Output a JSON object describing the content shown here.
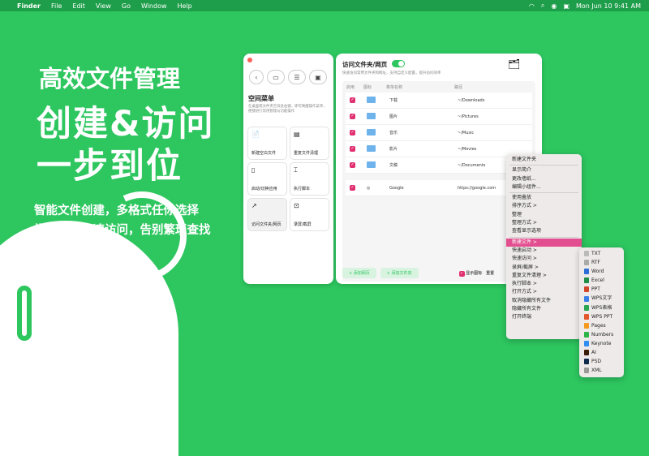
{
  "menubar": {
    "apple": "",
    "app": "Finder",
    "items": [
      "File",
      "Edit",
      "View",
      "Go",
      "Window",
      "Help"
    ],
    "datetime": "Mon Jun 10  9:41 AM"
  },
  "hero": {
    "line1": "高效文件管理",
    "line2": "创建&访问",
    "line3": "一步到位",
    "sub1": "智能文件创建，多格式任你选择",
    "sub2": "常用文件极速访问，告别繁琐查找"
  },
  "panel": {
    "title": "空间菜单",
    "desc": "在桌面或文件夹空白处右键，即可唤醒操作菜单，便捷进行常用管理与功能操作",
    "cards": [
      {
        "icon": "📄",
        "label": "新建空白文件"
      },
      {
        "icon": "▤",
        "label": "重复文件清理"
      },
      {
        "icon": "▯",
        "label": "启动/切换应用"
      },
      {
        "icon": "⌶",
        "label": "执行脚本"
      },
      {
        "icon": "↗",
        "label": "访问文件夹/网页"
      },
      {
        "icon": "⊡",
        "label": "录屏/截屏"
      }
    ]
  },
  "main": {
    "title": "访问文件夹/网页",
    "desc": "快速访问常用文件夹和网址，支持自定义配置，提升访问效率",
    "headers": [
      "启用",
      "图标",
      "菜单名称",
      "路径"
    ],
    "rows": [
      {
        "name": "下载",
        "path": "~/Downloads"
      },
      {
        "name": "图片",
        "path": "~/Pictures"
      },
      {
        "name": "音乐",
        "path": "~/Music"
      },
      {
        "name": "影片",
        "path": "~/Movies"
      },
      {
        "name": "文稿",
        "path": "~/Documents"
      }
    ],
    "web_row": {
      "name": "Google",
      "path": "https://google.com"
    },
    "add_web": "+ 添加网页",
    "add_folder": "+ 添加文件夹",
    "show_icon": "显示图标",
    "reset": "重置"
  },
  "context_menu": {
    "items": [
      "新建文件夹",
      "-",
      "显示简介",
      "更改墙纸...",
      "编辑小组件...",
      "-",
      "使用叠放",
      "排序方式 >",
      "整理",
      "整理方式 >",
      "查看显示选项",
      "-",
      "新建文件 >",
      "快速启动 >",
      "快速访问 >",
      "录屏/截屏 >",
      "重复文件清理 >",
      "执行脚本 >",
      "打开方式 >",
      "取消隐藏所有文件",
      "隐藏所有文件",
      "打开终端"
    ]
  },
  "submenu": {
    "items": [
      {
        "label": "TXT",
        "color": "#bbbbbb"
      },
      {
        "label": "RTF",
        "color": "#aaaaaa"
      },
      {
        "label": "Word",
        "color": "#2b6fd6"
      },
      {
        "label": "Excel",
        "color": "#1f8f48"
      },
      {
        "label": "PPT",
        "color": "#d2462b"
      },
      {
        "label": "WPS文字",
        "color": "#3a7ee8"
      },
      {
        "label": "WPS表格",
        "color": "#2aa653"
      },
      {
        "label": "WPS PPT",
        "color": "#e3562e"
      },
      {
        "label": "Pages",
        "color": "#f39a1f"
      },
      {
        "label": "Numbers",
        "color": "#2cb34a"
      },
      {
        "label": "Keynote",
        "color": "#2f8ef0"
      },
      {
        "label": "AI",
        "color": "#3a1e08"
      },
      {
        "label": "PSD",
        "color": "#0c2a4a"
      },
      {
        "label": "XML",
        "color": "#9a9a9a"
      }
    ]
  }
}
